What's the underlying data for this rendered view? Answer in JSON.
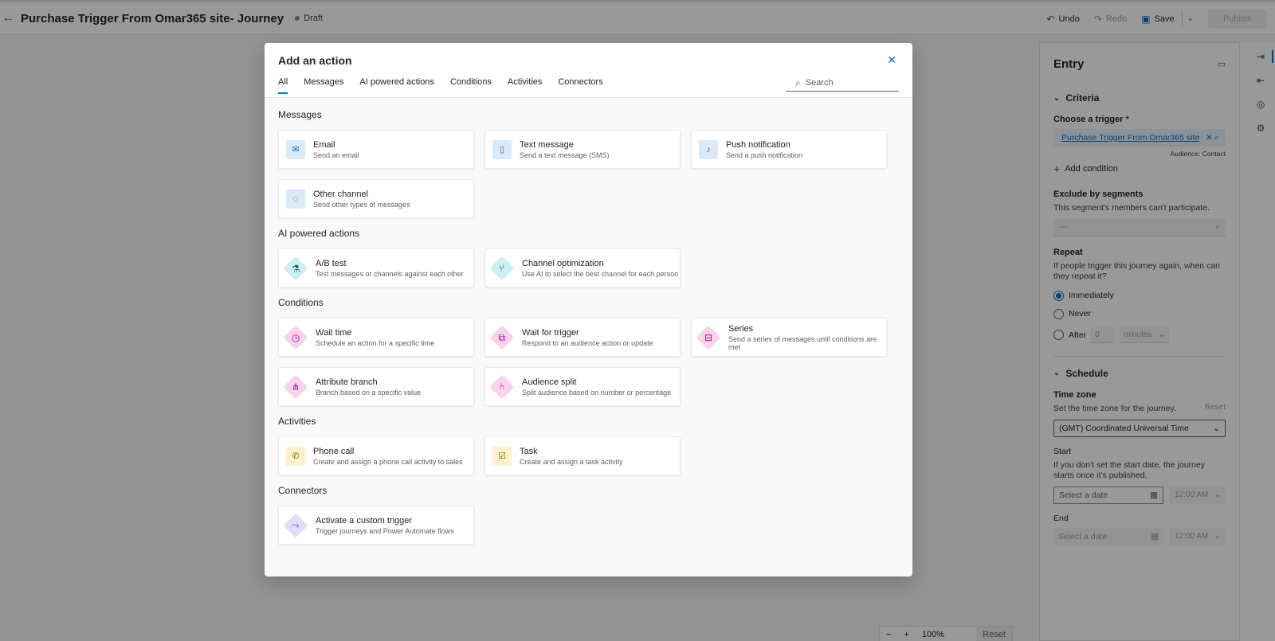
{
  "header": {
    "back_icon": "arrow-left-icon",
    "title": "Purchase Trigger From Omar365 site- Journey",
    "status": "Draft",
    "undo": "Undo",
    "redo": "Redo",
    "save": "Save",
    "publish": "Publish"
  },
  "zoom": {
    "minus": "−",
    "plus": "+",
    "level": "100%",
    "reset": "Reset"
  },
  "right_panel": {
    "title": "Entry",
    "criteria": {
      "heading": "Criteria",
      "trigger_label": "Choose a trigger",
      "trigger_required": "*",
      "trigger_value": "Purchase Trigger From Omar365 site",
      "audience_note": "Audience: Contact",
      "add_condition": "Add condition",
      "exclude_label": "Exclude by segments",
      "exclude_help": "This segment's members can't participate.",
      "exclude_placeholder": "---",
      "repeat_label": "Repeat",
      "repeat_help": "If people trigger this journey again, when can they repeat it?",
      "repeat_options": [
        "Immediately",
        "Never",
        "After"
      ],
      "repeat_selected": "Immediately",
      "after_value": "0",
      "after_unit": "minutes"
    },
    "schedule": {
      "heading": "Schedule",
      "tz_label": "Time zone",
      "tz_help": "Set the time zone for the journey.",
      "tz_reset": "Reset",
      "tz_value": "(GMT) Coordinated Universal Time",
      "start_label": "Start",
      "start_help": "If you don't set the start date, the journey starts once it's published.",
      "start_date_placeholder": "Select a date",
      "start_time": "12:00 AM",
      "end_label": "End",
      "end_date_placeholder": "Select a date",
      "end_time": "12:00 AM"
    }
  },
  "dialog": {
    "title": "Add an action",
    "tabs": [
      "All",
      "Messages",
      "AI powered actions",
      "Conditions",
      "Activities",
      "Connectors"
    ],
    "active_tab": "All",
    "search_placeholder": "Search",
    "groups": {
      "messages": {
        "title": "Messages",
        "items": [
          {
            "name": "Email",
            "desc": "Send an email",
            "icon": "mail-icon"
          },
          {
            "name": "Text message",
            "desc": "Send a text message (SMS)",
            "icon": "phone-icon"
          },
          {
            "name": "Push notification",
            "desc": "Send a push notification",
            "icon": "bell-icon"
          },
          {
            "name": "Other channel",
            "desc": "Send other types of messages",
            "icon": "channel-icon"
          }
        ]
      },
      "ai": {
        "title": "AI powered actions",
        "items": [
          {
            "name": "A/B test",
            "desc": "Test messages or channels against each other",
            "icon": "flask-icon"
          },
          {
            "name": "Channel optimization",
            "desc": "Use AI to select the best channel for each person",
            "icon": "branch-icon"
          }
        ]
      },
      "conditions": {
        "title": "Conditions",
        "items": [
          {
            "name": "Wait time",
            "desc": "Schedule an action for a specific time",
            "icon": "timer-icon"
          },
          {
            "name": "Wait for trigger",
            "desc": "Respond to an audience action or update",
            "icon": "trigger-icon"
          },
          {
            "name": "Series",
            "desc": "Send a series of messages until conditions are met",
            "icon": "series-icon"
          },
          {
            "name": "Attribute branch",
            "desc": "Branch based on a specific value",
            "icon": "hierarchy-icon"
          },
          {
            "name": "Audience split",
            "desc": "Split audience based on number or percentage",
            "icon": "split-icon"
          }
        ]
      },
      "activities": {
        "title": "Activities",
        "items": [
          {
            "name": "Phone call",
            "desc": "Create and assign a phone call activity to sales",
            "icon": "call-icon"
          },
          {
            "name": "Task",
            "desc": "Create and assign a task activity",
            "icon": "task-icon"
          }
        ]
      },
      "connectors": {
        "title": "Connectors",
        "items": [
          {
            "name": "Activate a custom trigger",
            "desc": "Trigger journeys and Power Automate flows",
            "icon": "custom-trigger-icon"
          }
        ]
      }
    }
  }
}
